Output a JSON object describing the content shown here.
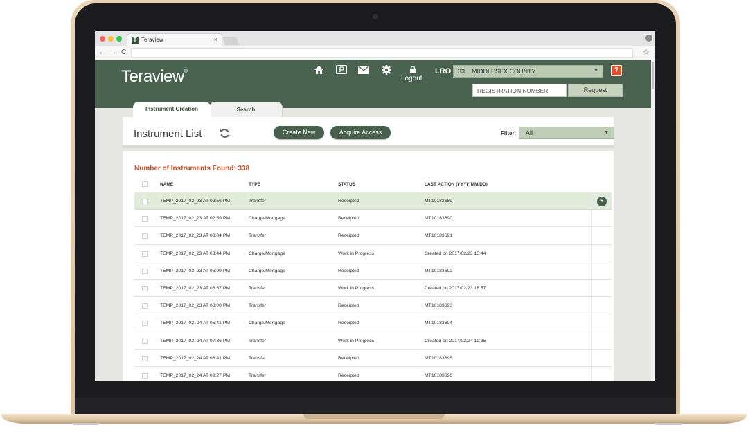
{
  "browser": {
    "tab_title": "Teraview",
    "tab_close": "×",
    "favicon": "T",
    "nav_back": "←",
    "nav_forward": "→",
    "nav_reload": "C",
    "bookmark_star": "☆"
  },
  "header": {
    "logo": "Teraview",
    "logo_mark": "®",
    "icons": [
      "home-icon",
      "parking-icon",
      "mail-icon",
      "gear-icon",
      "lock-icon"
    ],
    "logout_label": "Logout",
    "lro_label": "LRO",
    "lro_value": "33    MIDDLESEX COUNTY",
    "help_label": "?",
    "registration_placeholder": "REGISTRATION NUMBER",
    "request_label": "Request"
  },
  "tabs": [
    {
      "label": "Instrument Creation",
      "active": true
    },
    {
      "label": "Search",
      "active": false
    }
  ],
  "toolbar": {
    "title": "Instrument List",
    "create_label": "Create New",
    "acquire_label": "Acquire Access",
    "filter_label": "Filter:",
    "filter_value": "All"
  },
  "list": {
    "count_label": "Number of Instruments Found: 338",
    "columns": [
      "NAME",
      "TYPE",
      "STATUS",
      "LAST ACTION (YYYY/MM/DD)"
    ],
    "rows": [
      {
        "name": "TEMP_2017_02_23 AT 02:56 PM",
        "type": "Transfer",
        "status": "Receipted",
        "action": "MT10183689"
      },
      {
        "name": "TEMP_2017_02_23 AT 02:59 PM",
        "type": "Charge/Mortgage",
        "status": "Receipted",
        "action": "MT10183690"
      },
      {
        "name": "TEMP_2017_02_23 AT 03:04 PM",
        "type": "Transfer",
        "status": "Receipted",
        "action": "MT10183691"
      },
      {
        "name": "TEMP_2017_02_23 AT 03:44 PM",
        "type": "Charge/Mortgage",
        "status": "Work in Progress",
        "action": "Created on 2017/02/23 15:44"
      },
      {
        "name": "TEMP_2017_02_23 AT 05:09 PM",
        "type": "Charge/Mortgage",
        "status": "Receipted",
        "action": "MT10183692"
      },
      {
        "name": "TEMP_2017_02_23 AT 06:57 PM",
        "type": "Transfer",
        "status": "Work in Progress",
        "action": "Created on 2017/02/23 18:57"
      },
      {
        "name": "TEMP_2017_02_23 AT 08:00 PM",
        "type": "Transfer",
        "status": "Receipted",
        "action": "MT10183693"
      },
      {
        "name": "TEMP_2017_02_24 AT 05:41 PM",
        "type": "Charge/Mortgage",
        "status": "Receipted",
        "action": "MT10183694"
      },
      {
        "name": "TEMP_2017_02_24 AT 07:36 PM",
        "type": "Transfer",
        "status": "Work in Progress",
        "action": "Created on 2017/02/24 19:35"
      },
      {
        "name": "TEMP_2017_02_24 AT 08:41 PM",
        "type": "Transfer",
        "status": "Receipted",
        "action": "MT10183695"
      },
      {
        "name": "TEMP_2017_02_24 AT 09:27 PM",
        "type": "Transfer",
        "status": "Receipted",
        "action": "MT10183696"
      }
    ]
  },
  "colors": {
    "header_green": "#4a6350",
    "accent_orange": "#c8522a",
    "selected_row": "#e1ebd9"
  }
}
